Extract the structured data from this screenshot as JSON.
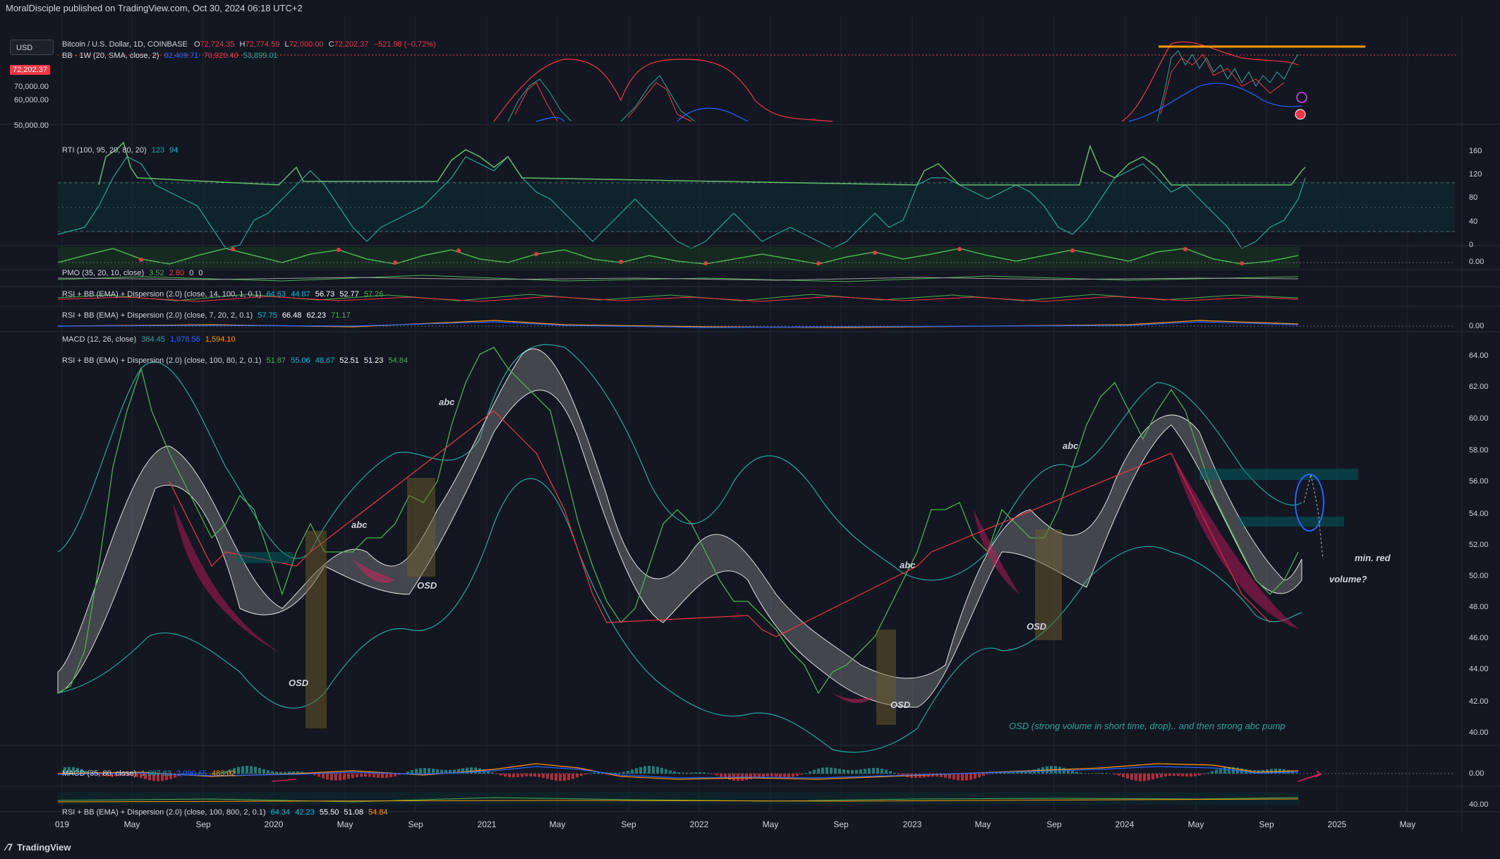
{
  "header": {
    "published": "MoralDisciple published on TradingView.com, Oct 30, 2024 06:18 UTC+2"
  },
  "toolbar": {
    "currency": "USD"
  },
  "main_pane": {
    "symbol": "Bitcoin / U.S. Dollar, 1D, COINBASE",
    "ohlc": {
      "o_label": "O",
      "o": "72,724.35",
      "h_label": "H",
      "h": "72,774.59",
      "l_label": "L",
      "l": "72,000.00",
      "c_label": "C",
      "c": "72,202.37",
      "change": "−521.98 (−0.72%)"
    },
    "bb_label": "BB · 1W (20, SMA, close, 2)",
    "bb_values": [
      "62,409.71",
      "70,920.40",
      "53,899.01"
    ],
    "last_price": "72,202.37",
    "price_ticks": [
      "70,000.00",
      "60,000.00",
      "50,000.00"
    ]
  },
  "panes": {
    "rti": {
      "label": "RTI (100, 95, 20, 80, 20)",
      "values": [
        "123",
        "94"
      ],
      "ticks": [
        "160",
        "120",
        "80",
        "40",
        "0"
      ]
    },
    "pmo": {
      "label": "PMO (35, 20, 10, close)",
      "values": [
        "3.52",
        "2.80",
        "0",
        "0"
      ],
      "ticks": [
        "0.00"
      ]
    },
    "rsi1": {
      "label": "RSI + BB (EMA) + Dispersion (2.0) (close, 14, 100, 1, 0.1)",
      "values": [
        "64.63",
        "44.87",
        "56.73",
        "52.77",
        "57.26"
      ]
    },
    "rsi2": {
      "label": "RSI + BB (EMA) + Dispersion (2.0) (close, 7, 20, 2, 0.1)",
      "values": [
        "57.75",
        "66.48",
        "62.23",
        "71.17"
      ]
    },
    "macd1": {
      "label": "MACD (12, 26, close)",
      "values": [
        "384.45",
        "1,978.56",
        "1,594.10"
      ],
      "ticks": [
        "0.00"
      ]
    },
    "rsi_main": {
      "label": "RSI + BB (EMA) + Dispersion (2.0) (close, 100, 80, 2, 0.1)",
      "values": [
        "51.87",
        "55.06",
        "48.67",
        "52.51",
        "51.23",
        "54.84"
      ],
      "ticks": [
        "64.00",
        "62.00",
        "60.00",
        "58.00",
        "56.00",
        "54.00",
        "52.00",
        "50.00",
        "48.00",
        "46.00",
        "44.00",
        "42.00",
        "40.00"
      ]
    },
    "macd2": {
      "label": "MACD (35, 80, close)",
      "values": [
        "1,607.63",
        "2,090.65",
        "483.02"
      ],
      "ticks": [
        "0.00"
      ]
    },
    "rsi3": {
      "label": "RSI + BB (EMA) + Dispersion (2.0) (close, 100, 800, 2, 0.1)",
      "values": [
        "64.34",
        "42.23",
        "55.50",
        "51.08",
        "54.84"
      ],
      "ticks": [
        "40.00"
      ]
    }
  },
  "annotations": {
    "abc": "abc",
    "osd": "OSD",
    "min_red": "min. red",
    "volume": "volume?",
    "note": "OSD (strong volume in short time, drop).. and then strong abc pump"
  },
  "time_axis": [
    "019",
    "May",
    "Sep",
    "2020",
    "May",
    "Sep",
    "2021",
    "May",
    "Sep",
    "2022",
    "May",
    "Sep",
    "2023",
    "May",
    "Sep",
    "2024",
    "May",
    "Sep",
    "2025",
    "May"
  ],
  "footer": {
    "brand": "TradingView"
  },
  "colors": {
    "background": "#131722",
    "up": "#26a69a",
    "down": "#f23645",
    "accent_orange": "#ff9800",
    "rsi_green": "#4caf50",
    "cyan": "#00bcd4"
  },
  "chart_data": {
    "type": "line",
    "x": [
      "2019-01",
      "2019-05",
      "2019-09",
      "2020-01",
      "2020-05",
      "2020-09",
      "2021-01",
      "2021-05",
      "2021-09",
      "2022-01",
      "2022-05",
      "2022-09",
      "2023-01",
      "2023-05",
      "2023-09",
      "2024-01",
      "2024-05",
      "2024-09",
      "2024-10"
    ],
    "series": [],
    "ylim": [
      40,
      64
    ]
  }
}
